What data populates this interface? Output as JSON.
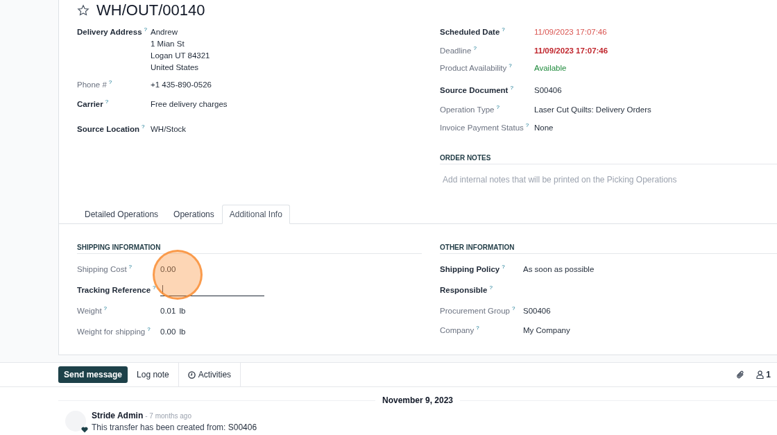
{
  "record": {
    "title": "WH/OUT/00140",
    "starred": false
  },
  "fields_left": [
    {
      "label": "Delivery Address",
      "tooltip": "?",
      "bold": true,
      "lines": [
        "Andrew",
        "1 Mian St",
        "Logan UT 84321",
        "United States"
      ]
    },
    {
      "label": "Phone #",
      "tooltip": "?",
      "bold": false,
      "value": "+1 435-890-0526"
    },
    {
      "label": "Carrier",
      "tooltip": "?",
      "bold": true,
      "value": "Free delivery charges"
    },
    {
      "label": "Source Location",
      "tooltip": "?",
      "bold": true,
      "value": "WH/Stock"
    }
  ],
  "fields_right": [
    {
      "label": "Scheduled Date",
      "tooltip": "?",
      "bold": true,
      "value": "11/09/2023 17:07:46",
      "color": "#d9534f",
      "value_bold": false
    },
    {
      "label": "Deadline",
      "tooltip": "?",
      "bold": false,
      "value": "11/09/2023 17:07:46",
      "color": "#c0262d",
      "value_bold": true
    },
    {
      "label": "Product Availability",
      "tooltip": "?",
      "bold": false,
      "value": "Available",
      "color": "#1e8a3b",
      "value_bold": false
    },
    {
      "label": "Source Document",
      "tooltip": "?",
      "bold": true,
      "value": "S00406",
      "color": "#1f2937",
      "value_bold": false
    },
    {
      "label": "Operation Type",
      "tooltip": "?",
      "bold": false,
      "value": "Laser Cut Quilts: Delivery Orders",
      "color": "#1f2937",
      "value_bold": false
    },
    {
      "label": "Invoice Payment Status",
      "tooltip": "?",
      "bold": false,
      "value": "None",
      "color": "#1f2937",
      "value_bold": false
    }
  ],
  "order_notes": {
    "heading": "ORDER NOTES",
    "placeholder": "Add internal notes that will be printed on the Picking Operations"
  },
  "tabs": [
    {
      "label": "Detailed Operations",
      "selected": false
    },
    {
      "label": "Operations",
      "selected": false
    },
    {
      "label": "Additional Info",
      "selected": true
    }
  ],
  "shipping_information": {
    "heading": "SHIPPING INFORMATION",
    "fields": [
      {
        "label": "Shipping Cost",
        "tooltip": "?",
        "bold": false,
        "value": "0.00"
      },
      {
        "label": "Tracking Reference",
        "tooltip": "?",
        "bold": true,
        "kind": "input",
        "focused": true
      },
      {
        "label": "Weight",
        "tooltip": "?",
        "bold": false,
        "value": "0.01",
        "unit": "lb"
      },
      {
        "label": "Weight for shipping",
        "tooltip": "?",
        "bold": false,
        "value": "0.00",
        "unit": "lb"
      }
    ]
  },
  "other_information": {
    "heading": "OTHER INFORMATION",
    "fields": [
      {
        "label": "Shipping Policy",
        "tooltip": "?",
        "bold": true,
        "value": "As soon as possible"
      },
      {
        "label": "Responsible",
        "tooltip": "?",
        "bold": true
      },
      {
        "label": "Procurement Group",
        "tooltip": "?",
        "bold": false,
        "value": "S00406"
      },
      {
        "label": "Company",
        "tooltip": "?",
        "bold": false,
        "value": "My Company"
      }
    ]
  },
  "chatter": {
    "buttons": [
      {
        "label": "Send message",
        "selected": true
      },
      {
        "label": "Log note",
        "selected": false
      },
      {
        "label": "Activities",
        "selected": false
      }
    ],
    "follower_count": "1",
    "date_separator": "November 9, 2023",
    "messages": [
      {
        "author": "Stride Admin",
        "time": "- 7 months ago",
        "body": "This transfer has been created from:",
        "link": "S00406"
      }
    ]
  }
}
